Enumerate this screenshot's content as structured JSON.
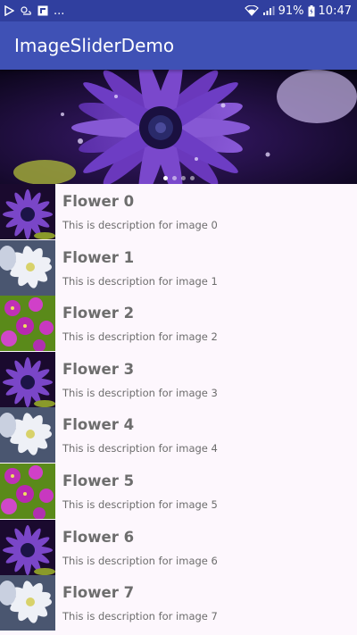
{
  "status_bar": {
    "battery": "91%",
    "time": "10:47",
    "left_icons": [
      "play-icon",
      "weather-icon",
      "app-icon",
      "more-dots-icon"
    ],
    "more": "...",
    "background": "#303f9f"
  },
  "app_bar": {
    "title": "ImageSliderDemo",
    "background": "#3f51b5"
  },
  "slider": {
    "slide_count": 4,
    "active_index": 0
  },
  "list": {
    "items": [
      {
        "title": "Flower 0",
        "description": "This is description for image 0",
        "thumb": "purple"
      },
      {
        "title": "Flower 1",
        "description": "This is description for image 1",
        "thumb": "white"
      },
      {
        "title": "Flower 2",
        "description": "This is description for image 2",
        "thumb": "magenta"
      },
      {
        "title": "Flower 3",
        "description": "This is description for image 3",
        "thumb": "purple"
      },
      {
        "title": "Flower 4",
        "description": "This is description for image 4",
        "thumb": "white"
      },
      {
        "title": "Flower 5",
        "description": "This is description for image 5",
        "thumb": "magenta"
      },
      {
        "title": "Flower 6",
        "description": "This is description for image 6",
        "thumb": "purple"
      },
      {
        "title": "Flower 7",
        "description": "This is description for image 7",
        "thumb": "white"
      }
    ]
  }
}
